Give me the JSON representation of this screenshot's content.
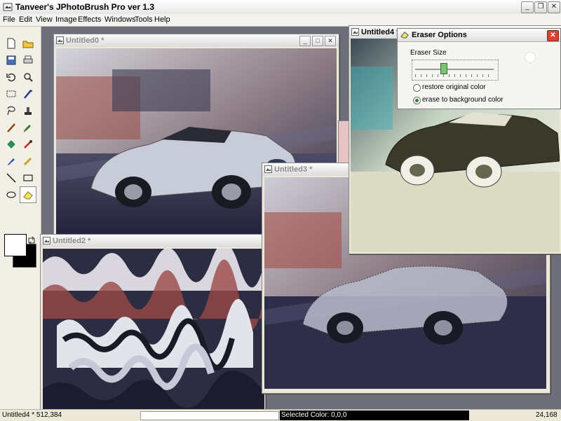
{
  "app": {
    "title": "Tanveer's  JPhotoBrush Pro ver 1.3"
  },
  "menu": [
    "File",
    "Edit",
    "View",
    "Image",
    "Effects",
    "Windows",
    "Tools",
    "Help"
  ],
  "tools": [
    "new-file",
    "open-file",
    "save",
    "print",
    "undo",
    "zoom",
    "select-rect",
    "magic-wand",
    "lasso",
    "stamp",
    "brush",
    "airbrush",
    "fill",
    "color-picker",
    "pen",
    "clone",
    "line",
    "rectangle",
    "ellipse",
    "eraser"
  ],
  "windows": {
    "w0": {
      "title": "Untitled0 *"
    },
    "w2": {
      "title": "Untitled2 *"
    },
    "w3": {
      "title": "Untitled3 *"
    },
    "w4": {
      "title": "Untitled4 *"
    }
  },
  "dialog": {
    "title": "Eraser Options",
    "size_label": "Eraser Size",
    "size_value_fraction": 0.35,
    "option1": "restore original color",
    "option2": "erase to background color",
    "selected": "option2"
  },
  "status": {
    "left": "Untitled4 *  512,384",
    "selected_color": "Selected  Color: 0,0,0",
    "coords": "24,168"
  },
  "colors": {
    "foreground": "#ffffff",
    "background": "#000000",
    "accent": "#3a7a2e"
  }
}
